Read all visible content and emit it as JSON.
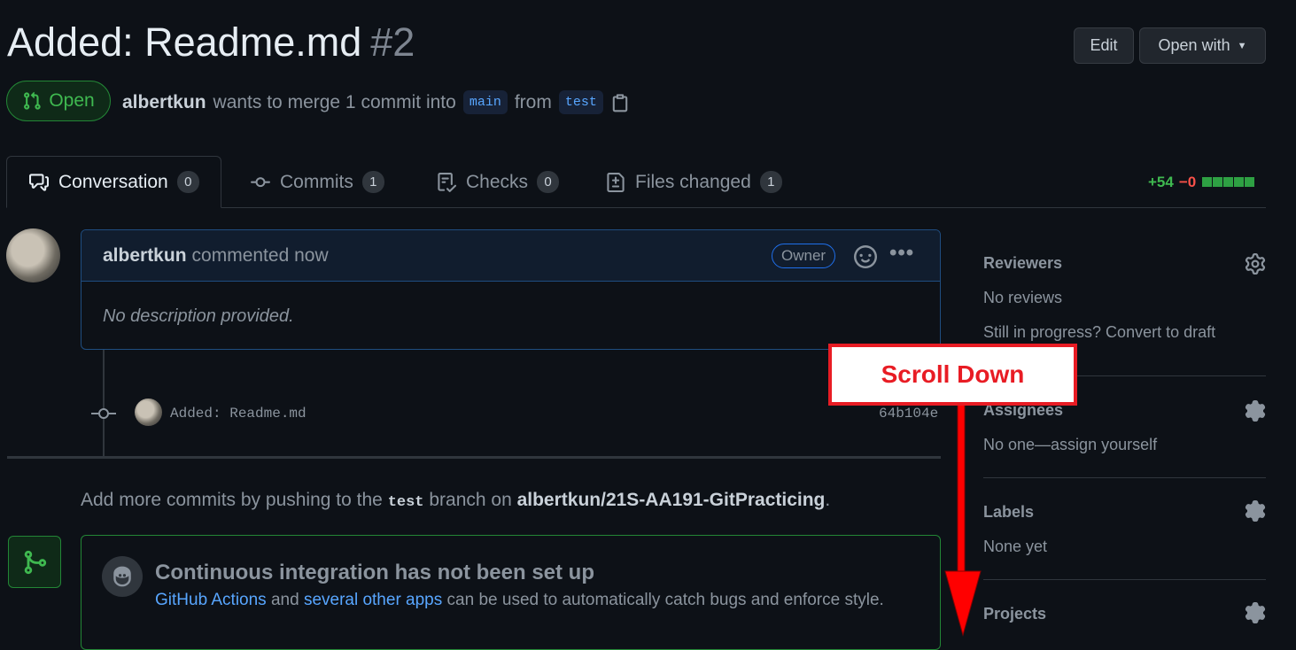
{
  "pr": {
    "title": "Added: Readme.md",
    "number": "#2",
    "state": "Open",
    "author": "albertkun",
    "merge_text": "wants to merge 1 commit into",
    "base_branch": "main",
    "from_text": "from",
    "head_branch": "test"
  },
  "header_buttons": {
    "edit": "Edit",
    "open_with": "Open with"
  },
  "tabs": [
    {
      "label": "Conversation",
      "count": "0"
    },
    {
      "label": "Commits",
      "count": "1"
    },
    {
      "label": "Checks",
      "count": "0"
    },
    {
      "label": "Files changed",
      "count": "1"
    }
  ],
  "diffstat": {
    "additions": "+54",
    "deletions": "−0"
  },
  "comment": {
    "author": "albertkun",
    "meta": "commented now",
    "badge": "Owner",
    "body": "No description provided."
  },
  "commit": {
    "message": "Added: Readme.md",
    "sha": "64b104e"
  },
  "push_hint": {
    "pre": "Add more commits by pushing to the",
    "branch": "test",
    "mid": "branch on",
    "repo": "albertkun/21S-AA191-GitPracticing",
    "post": "."
  },
  "ci": {
    "title": "Continuous integration has not been set up",
    "link1": "GitHub Actions",
    "and": "and",
    "link2": "several other apps",
    "rest": "can be used to automatically catch bugs and enforce style."
  },
  "sidebar": {
    "reviewers": {
      "title": "Reviewers",
      "value": "No reviews",
      "extra": "Still in progress? Convert to draft"
    },
    "assignees": {
      "title": "Assignees",
      "value": "No one—assign yourself"
    },
    "labels": {
      "title": "Labels",
      "value": "None yet"
    },
    "projects": {
      "title": "Projects"
    }
  },
  "annotation": {
    "label": "Scroll Down",
    "color": "#e81c24"
  },
  "colors": {
    "accent": "#58a6ff",
    "success": "#3fb950",
    "danger": "#f85149"
  }
}
